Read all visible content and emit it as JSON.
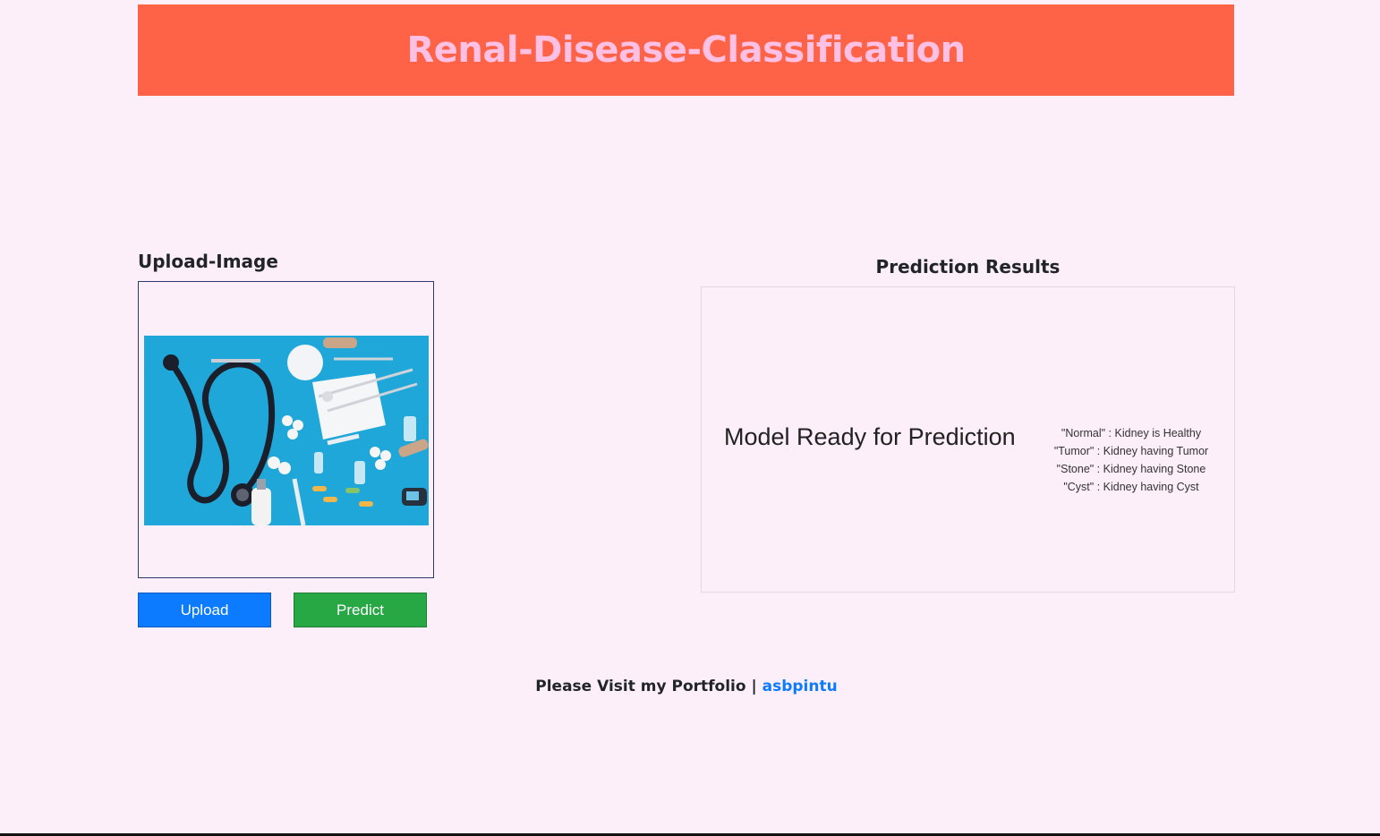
{
  "header": {
    "title": "Renal-Disease-Classification"
  },
  "upload": {
    "title": "Upload-Image",
    "upload_button": "Upload",
    "predict_button": "Predict"
  },
  "results": {
    "title": "Prediction Results",
    "status": "Model Ready for Prediction",
    "legend": [
      "\"Normal\" : Kidney is Healthy",
      "\"Tumor\" : Kidney having Tumor",
      "\"Stone\" : Kidney having Stone",
      "\"Cyst\" : Kidney having Cyst"
    ]
  },
  "footer": {
    "text": "Please Visit my Portfolio |",
    "link_text": "asbpintu"
  },
  "colors": {
    "background": "#fdeff9",
    "header_bg": "#ff6347",
    "header_text": "#ffc0e3",
    "upload_button": "#0d7bff",
    "predict_button": "#28a745",
    "link": "#0d7bff"
  },
  "preview_image": {
    "subject": "medical-supplies-photo"
  }
}
